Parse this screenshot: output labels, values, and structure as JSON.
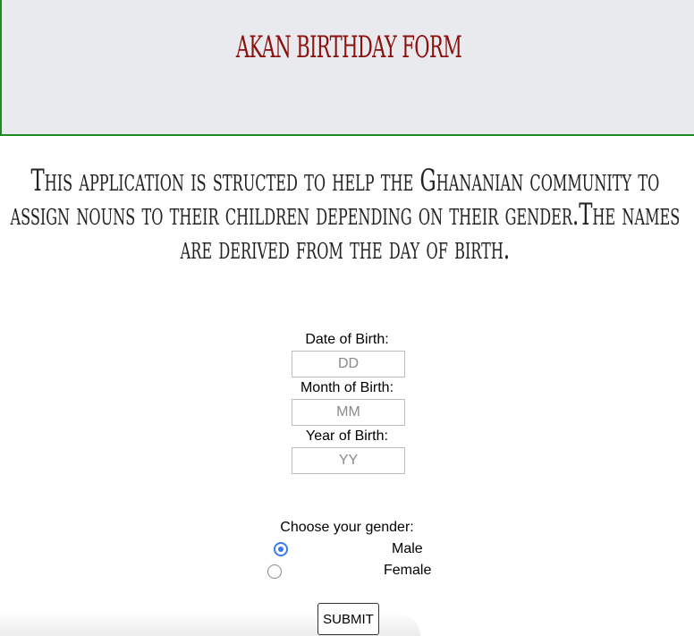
{
  "header": {
    "title": "Akan birthday form"
  },
  "intro": {
    "text": "This application is structed to help the Ghananian community to assign nouns to their children depending on their gender.The names are derived from the day of birth."
  },
  "form": {
    "day": {
      "label": "Date of Birth:",
      "placeholder": "DD",
      "value": ""
    },
    "month": {
      "label": "Month of Birth:",
      "placeholder": "MM",
      "value": ""
    },
    "year": {
      "label": "Year of Birth:",
      "placeholder": "YY",
      "value": ""
    },
    "gender": {
      "label": "Choose your gender:",
      "options": [
        {
          "label": "Male",
          "selected": true
        },
        {
          "label": "Female",
          "selected": false
        }
      ]
    },
    "submit_label": "SUBMIT"
  },
  "colors": {
    "title": "#8b1010",
    "header_bg": "#e8eaed",
    "header_border": "#1f8a1f",
    "radio_accent": "#3a7af0"
  }
}
